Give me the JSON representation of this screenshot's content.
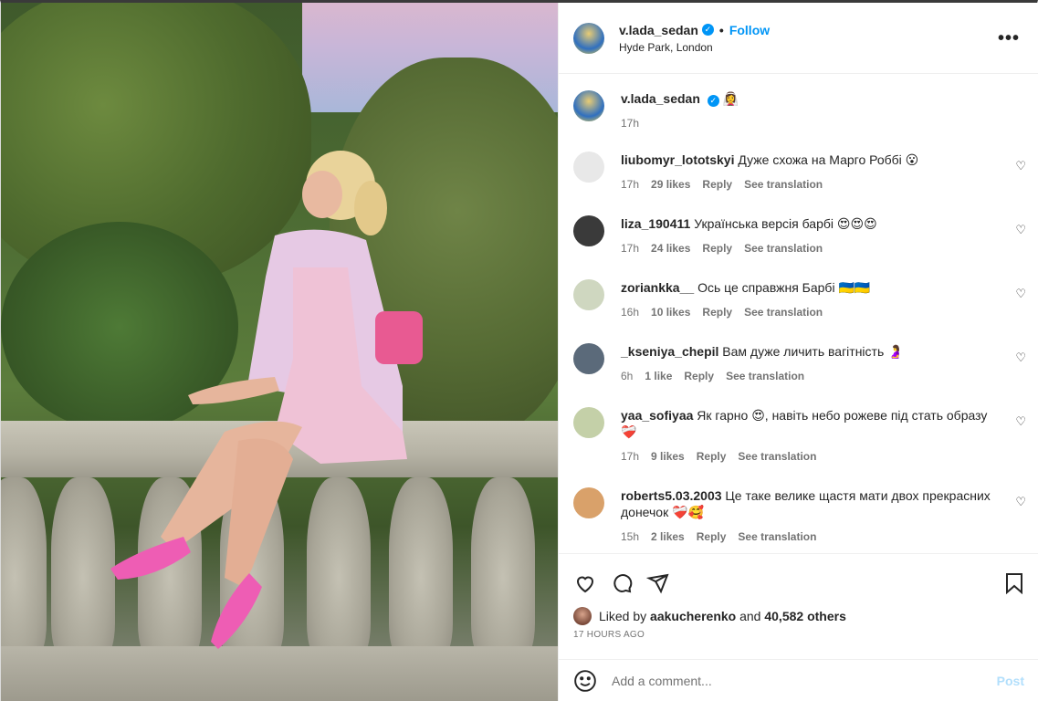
{
  "header": {
    "username": "v.lada_sedan",
    "follow_label": "Follow",
    "location": "Hyde Park, London",
    "dot": "•",
    "more_icon": "more-horizontal-icon"
  },
  "caption": {
    "username": "v.lada_sedan",
    "emoji": "👰‍♀️",
    "time": "17h"
  },
  "comments": [
    {
      "user": "liubomyr_lototskyi",
      "text": "Дуже схожа на Марго Роббі 😮",
      "time": "17h",
      "likes": "29 likes",
      "reply": "Reply",
      "translate": "See translation"
    },
    {
      "user": "liza_190411",
      "text": "Українська версія барбі 😍😍😍",
      "time": "17h",
      "likes": "24 likes",
      "reply": "Reply",
      "translate": "See translation"
    },
    {
      "user": "zoriankka__",
      "text": "Ось це справжня Барбі 🇺🇦🇺🇦",
      "time": "16h",
      "likes": "10 likes",
      "reply": "Reply",
      "translate": "See translation"
    },
    {
      "user": "_kseniya_chepil",
      "text": "Вам дуже личить вагітність 🤰",
      "time": "6h",
      "likes": "1 like",
      "reply": "Reply",
      "translate": "See translation"
    },
    {
      "user": "yaa_sofiyaa",
      "text": "Як гарно 😍, навіть небо рожеве під стать образу ❤️‍🩹",
      "time": "17h",
      "likes": "9 likes",
      "reply": "Reply",
      "translate": "See translation"
    },
    {
      "user": "roberts5.03.2003",
      "text": "Це таке велике щастя мати двох прекрасних донечок ❤️‍🩹🥰",
      "time": "15h",
      "likes": "2 likes",
      "reply": "Reply",
      "translate": "See translation"
    }
  ],
  "likes": {
    "prefix": "Liked by",
    "user": "aakucherenko",
    "and": "and",
    "others": "40,582 others"
  },
  "timestamp": "17 hours ago",
  "comment_box": {
    "placeholder": "Add a comment...",
    "post_label": "Post"
  },
  "colors": {
    "accent": "#0095f6",
    "post_disabled": "#b2dffc",
    "muted": "#737373"
  }
}
